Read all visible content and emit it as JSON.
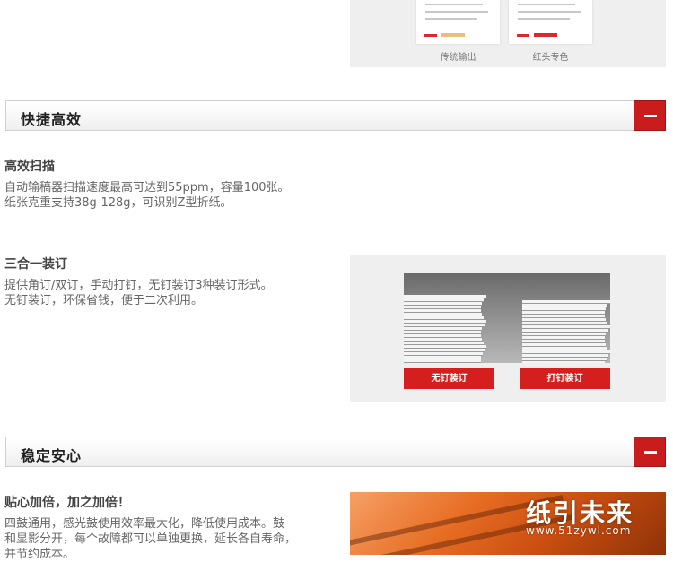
{
  "top_panel": {
    "captions": [
      "传统输出",
      "红头专色"
    ]
  },
  "sections": [
    {
      "title": "快捷高效",
      "blocks": [
        {
          "heading": "高效扫描",
          "lines": [
            "自动输稿器扫描速度最高可达到55ppm，容量100张。",
            "纸张克重支持38g-128g，可识别Z型折纸。"
          ]
        },
        {
          "heading": "三合一装订",
          "lines": [
            "提供角订/双订，手动打钉，无钉装订3种装订形式。",
            "无钉装订，环保省钱，便于二次利用。"
          ]
        }
      ]
    },
    {
      "title": "稳定安心",
      "blocks": [
        {
          "heading": "贴心加倍，加之加倍！",
          "lines": [
            "四鼓通用，感光鼓使用效率最大化，降低使用成本。鼓",
            "和显影分开，每个故障都可以单独更换，延长各自寿命，",
            "并节约成本。"
          ]
        }
      ]
    }
  ],
  "binding_image": {
    "labels": [
      "无钉装订",
      "打钉装订"
    ]
  },
  "watermark": {
    "brand": "纸引未来",
    "url": "www.51zywl.com"
  },
  "colors": {
    "accent_red": "#c91c1c",
    "drum_orange": "#e76e24"
  }
}
